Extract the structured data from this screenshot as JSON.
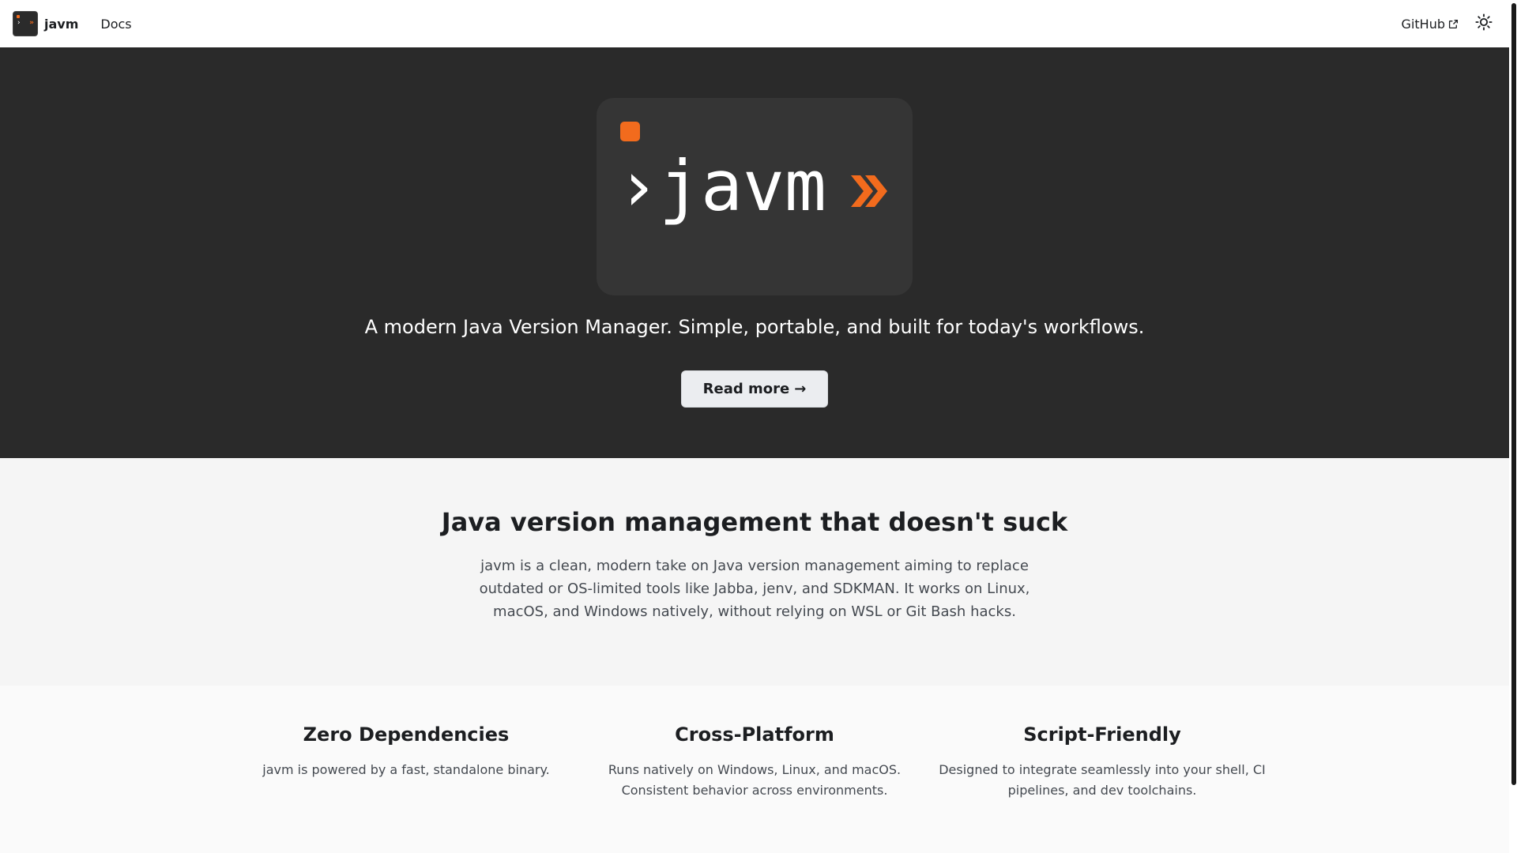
{
  "navbar": {
    "brand_title": "javm",
    "docs_label": "Docs",
    "github_label": "GitHub"
  },
  "hero": {
    "logo_text": "›javm",
    "tagline": "A modern Java Version Manager. Simple, portable, and built for today's workflows.",
    "read_more_label": "Read more",
    "read_more_arrow": "→"
  },
  "intro": {
    "heading": "Java version management that doesn't suck",
    "body": "javm is a clean, modern take on Java version management aiming to replace outdated or OS-limited tools like Jabba, jenv, and SDKMAN. It works on Linux, macOS, and Windows natively, without relying on WSL or Git Bash hacks."
  },
  "features": [
    {
      "title": "Zero Dependencies",
      "description": "javm is powered by a fast, standalone binary."
    },
    {
      "title": "Cross-Platform",
      "description": "Runs natively on Windows, Linux, and macOS. Consistent behavior across environments."
    },
    {
      "title": "Script-Friendly",
      "description": "Designed to integrate seamlessly into your shell, CI pipelines, and dev toolchains."
    }
  ],
  "icons": {
    "external_link": "external-link-icon",
    "theme_toggle": "sun-icon"
  },
  "colors": {
    "accent": "#f26b1d",
    "hero_bg": "#2a2a2a",
    "card_bg": "#353535"
  }
}
